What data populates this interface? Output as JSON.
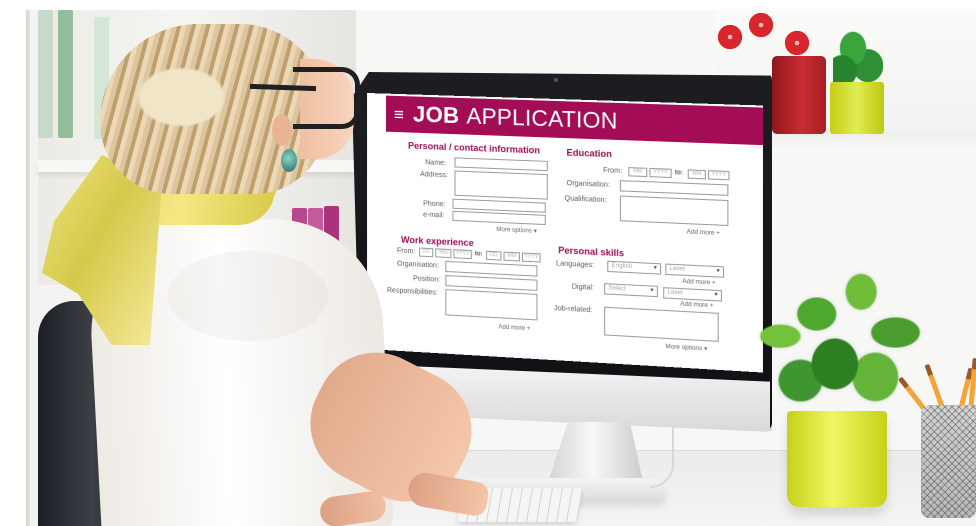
{
  "screen": {
    "header": {
      "menu_icon": "≡",
      "title_bold": "JOB",
      "title_rest": "APPLICATION"
    },
    "personal": {
      "title": "Personal / contact information",
      "name_label": "Name:",
      "address_label": "Address:",
      "phone_label": "Phone:",
      "email_label": "e-mail:",
      "more_options": "More options ▾"
    },
    "education": {
      "title": "Education",
      "from_label": "From:",
      "to_label": "to:",
      "date_mm": "MM",
      "date_yyyy": "YYYY",
      "organisation_label": "Organisation:",
      "qualification_label": "Qualification:",
      "add_more": "Add more +"
    },
    "work": {
      "title": "Work experience",
      "from_label": "From:",
      "to_label": "to:",
      "date_dd": "DD",
      "date_mm": "MM",
      "date_yyyy": "YYYY",
      "organisation_label": "Organisation:",
      "position_label": "Position:",
      "responsibilities_label": "Responsibilities:",
      "add_more": "Add more +"
    },
    "skills": {
      "title": "Personal skills",
      "languages_label": "Languages:",
      "language_value": "English",
      "level_value": "Level",
      "digital_label": "Digital:",
      "digital_value": "Select",
      "add_more": "Add more +",
      "job_related_label": "Job-related:",
      "more_options": "More options ▾"
    }
  },
  "colors": {
    "accent": "#a20d55",
    "field_border": "#9c9c9c",
    "text": "#5d5d5d"
  }
}
